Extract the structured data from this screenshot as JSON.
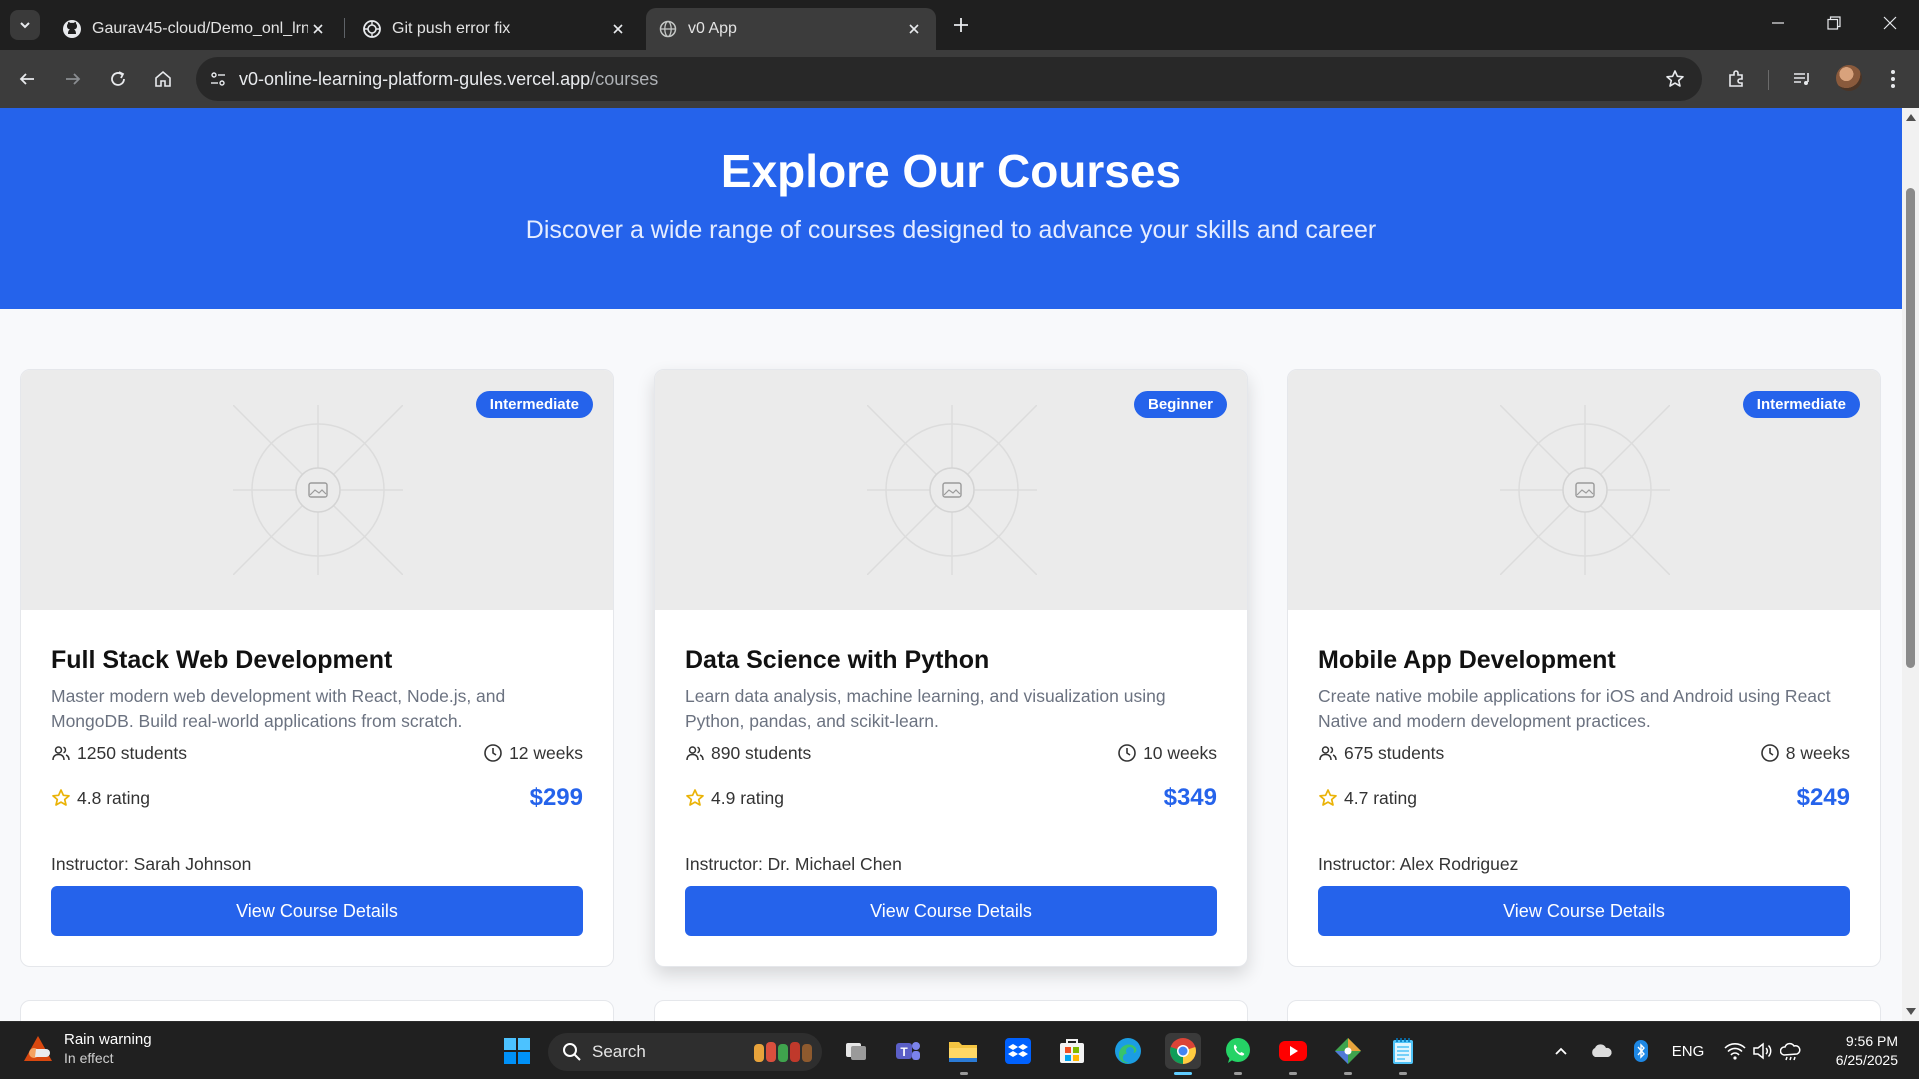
{
  "browser": {
    "tabs": [
      {
        "title": "Gaurav45-cloud/Demo_onl_lrng",
        "icon": "github-icon"
      },
      {
        "title": "Git push error fix",
        "icon": "chatgpt-icon"
      },
      {
        "title": "v0 App",
        "icon": "globe-icon",
        "active": true
      }
    ],
    "url": {
      "host": "v0-online-learning-platform-gules.vercel.app",
      "path": "/courses"
    }
  },
  "page": {
    "hero": {
      "title": "Explore Our Courses",
      "subtitle": "Discover a wide range of courses designed to advance your skills and career"
    },
    "courses": [
      {
        "level": "Intermediate",
        "title": "Full Stack Web Development",
        "description": "Master modern web development with React, Node.js, and MongoDB. Build real-world applications from scratch.",
        "students": "1250 students",
        "duration": "12 weeks",
        "rating": "4.8 rating",
        "price": "$299",
        "instructor": "Instructor: Sarah Johnson",
        "cta": "View Course Details"
      },
      {
        "level": "Beginner",
        "title": "Data Science with Python",
        "description": "Learn data analysis, machine learning, and visualization using Python, pandas, and scikit-learn.",
        "students": "890 students",
        "duration": "10 weeks",
        "rating": "4.9 rating",
        "price": "$349",
        "instructor": "Instructor: Dr. Michael Chen",
        "cta": "View Course Details"
      },
      {
        "level": "Intermediate",
        "title": "Mobile App Development",
        "description": "Create native mobile applications for iOS and Android using React Native and modern development practices.",
        "students": "675 students",
        "duration": "8 weeks",
        "rating": "4.7 rating",
        "price": "$249",
        "instructor": "Instructor: Alex Rodriguez",
        "cta": "View Course Details"
      }
    ]
  },
  "colors": {
    "accent": "#2563eb",
    "star": "#eab308"
  },
  "taskbar": {
    "weather": {
      "title": "Rain warning",
      "subtitle": "In effect"
    },
    "search_label": "Search",
    "language": "ENG",
    "time": "9:56 PM",
    "date": "6/25/2025"
  }
}
